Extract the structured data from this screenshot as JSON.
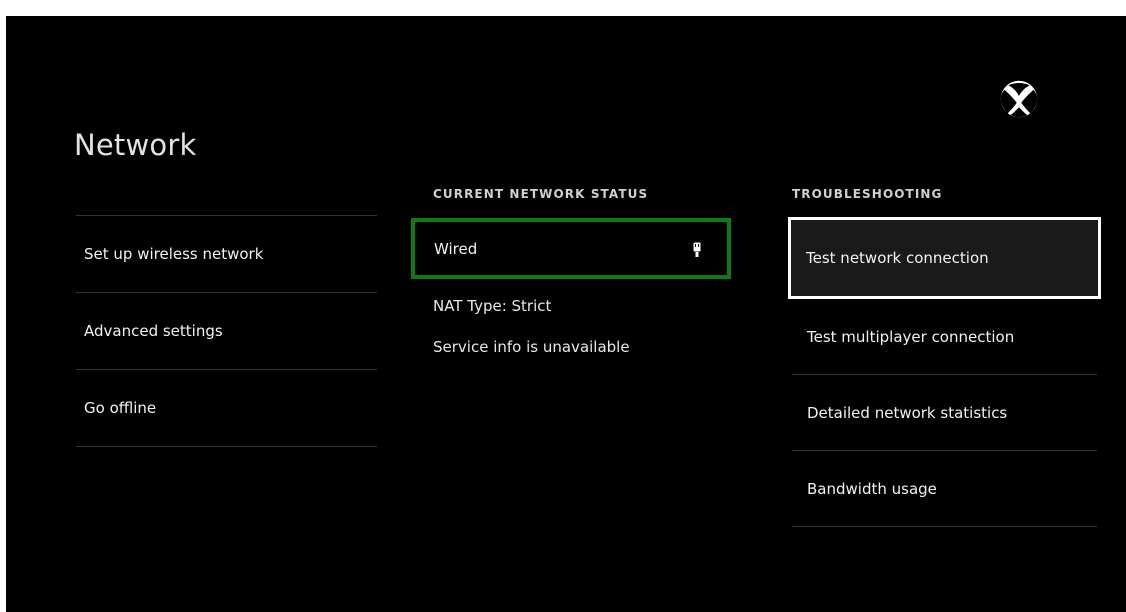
{
  "page": {
    "title": "Network"
  },
  "colors": {
    "background": "#000000",
    "accent_green": "#107c10",
    "focus_border": "#ffffff"
  },
  "left_menu": {
    "items": [
      {
        "label": "Set up wireless network"
      },
      {
        "label": "Advanced settings"
      },
      {
        "label": "Go offline"
      }
    ]
  },
  "status": {
    "heading": "CURRENT NETWORK STATUS",
    "connection": "Wired",
    "connection_icon": "ethernet-plug-icon",
    "nat_type": "NAT Type: Strict",
    "service_info": "Service info is unavailable"
  },
  "troubleshooting": {
    "heading": "TROUBLESHOOTING",
    "items": [
      {
        "label": "Test network connection",
        "selected": true
      },
      {
        "label": "Test multiplayer connection",
        "selected": false
      },
      {
        "label": "Detailed network statistics",
        "selected": false
      },
      {
        "label": "Bandwidth usage",
        "selected": false
      }
    ]
  },
  "logo": {
    "icon": "xbox-logo-icon"
  }
}
